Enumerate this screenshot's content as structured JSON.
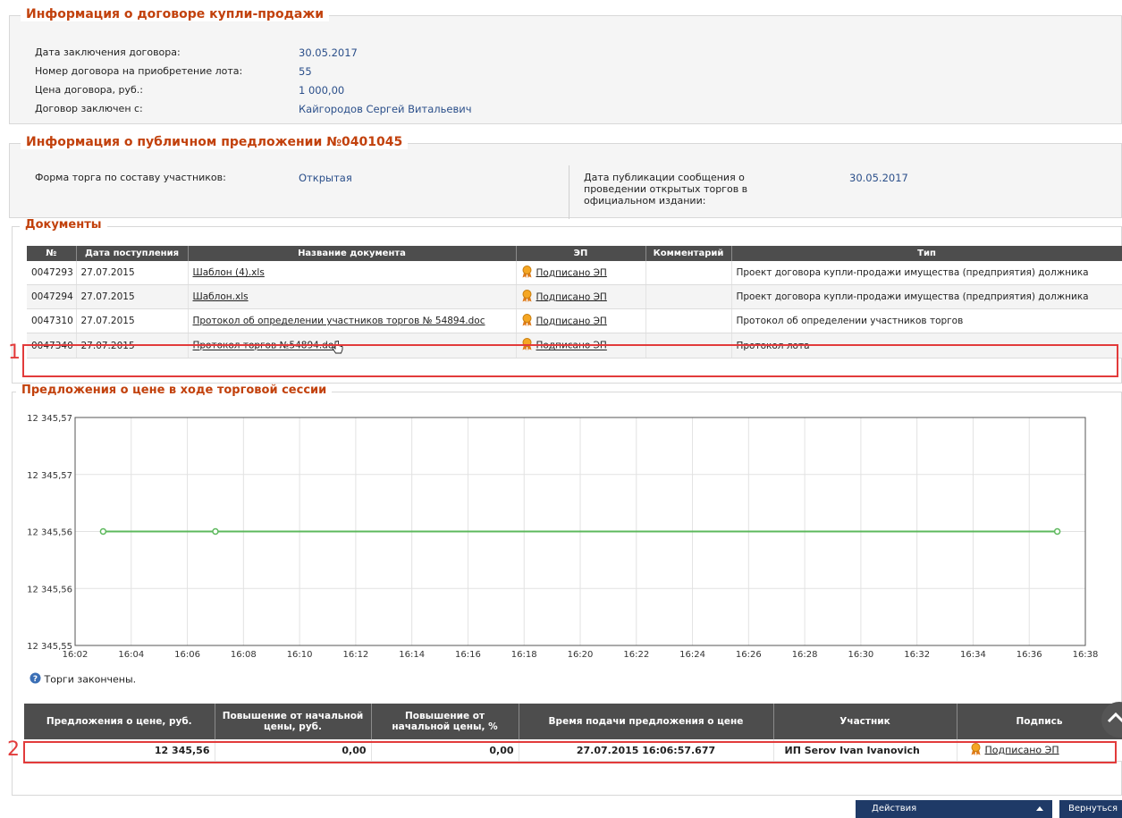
{
  "contract": {
    "title": "Информация о договоре купли-продажи",
    "rows": [
      {
        "label": "Дата заключения договора:",
        "value": "30.05.2017"
      },
      {
        "label": "Номер договора на приобретение лота:",
        "value": "55"
      },
      {
        "label": "Цена договора, руб.:",
        "value": "1 000,00"
      },
      {
        "label": "Договор заключен с:",
        "value": "Кайгородов Сергей Витальевич"
      }
    ]
  },
  "offer": {
    "title": "Информация о публичном предложении №0401045",
    "form_label": "Форма торга по составу участников:",
    "form_value": "Открытая",
    "pub_label_lines": [
      "Дата публикации сообщения о",
      "проведении открытых торгов в",
      "официальном издании:"
    ],
    "pub_value": "30.05.2017"
  },
  "documents": {
    "title": "Документы",
    "columns": [
      "№",
      "Дата поступления",
      "Название документа",
      "ЭП",
      "Комментарий",
      "Тип"
    ],
    "rows": [
      {
        "num": "0047293",
        "date": "27.07.2015",
        "name": "Шаблон (4).xls",
        "sig": "Подписано ЭП",
        "comment": "",
        "type": "Проект договора купли-продажи имущества (предприятия) должника"
      },
      {
        "num": "0047294",
        "date": "27.07.2015",
        "name": "Шаблон.xls",
        "sig": "Подписано ЭП",
        "comment": "",
        "type": "Проект договора купли-продажи имущества (предприятия) должника"
      },
      {
        "num": "0047310",
        "date": "27.07.2015",
        "name": "Протокол об определении участников торгов № 54894.doc",
        "sig": "Подписано ЭП",
        "comment": "",
        "type": "Протокол об определении участников торгов"
      },
      {
        "num": "0047340",
        "date": "27.07.2015",
        "name": "Протокол торгов №54894.doc",
        "sig": "Подписано ЭП",
        "comment": "",
        "type": "Протокол лота"
      }
    ]
  },
  "annotations": {
    "one": "1",
    "two": "2"
  },
  "session": {
    "title": "Предложения о цене в ходе торговой сессии",
    "status": "Торги закончены."
  },
  "chart_data": {
    "type": "line",
    "title": "",
    "xlabel": "",
    "ylabel": "",
    "x_ticks": [
      "16:02",
      "16:04",
      "16:06",
      "16:08",
      "16:10",
      "16:12",
      "16:14",
      "16:16",
      "16:18",
      "16:20",
      "16:22",
      "16:24",
      "16:26",
      "16:28",
      "16:30",
      "16:32",
      "16:34",
      "16:36",
      "16:38"
    ],
    "y_ticks": [
      "12 345,57",
      "12 345,57",
      "12 345,56",
      "12 345,56",
      "12 345,55"
    ],
    "xlim": [
      "16:02",
      "16:38"
    ],
    "ylim": [
      12345.55,
      12345.57
    ],
    "grid": true,
    "series": [
      {
        "color": "#5cb85c",
        "x": [
          "16:03",
          "16:07",
          "16:37"
        ],
        "y": [
          12345.56,
          12345.56,
          12345.56
        ]
      }
    ]
  },
  "bids": {
    "columns": [
      "Предложения о цене, руб.",
      "Повышение от начальной цены, руб.",
      "Повышение от начальной цены, %",
      "Время подачи предложения о цене",
      "Участник",
      "Подпись"
    ],
    "rows": [
      {
        "price": "12 345,56",
        "raise_rub": "0,00",
        "raise_pct": "0,00",
        "time": "27.07.2015 16:06:57.677",
        "participant": "ИП Serov Ivan Ivanovich",
        "sig": "Подписано ЭП"
      }
    ]
  },
  "footer": {
    "actions": "Действия",
    "back": "Вернуться"
  }
}
